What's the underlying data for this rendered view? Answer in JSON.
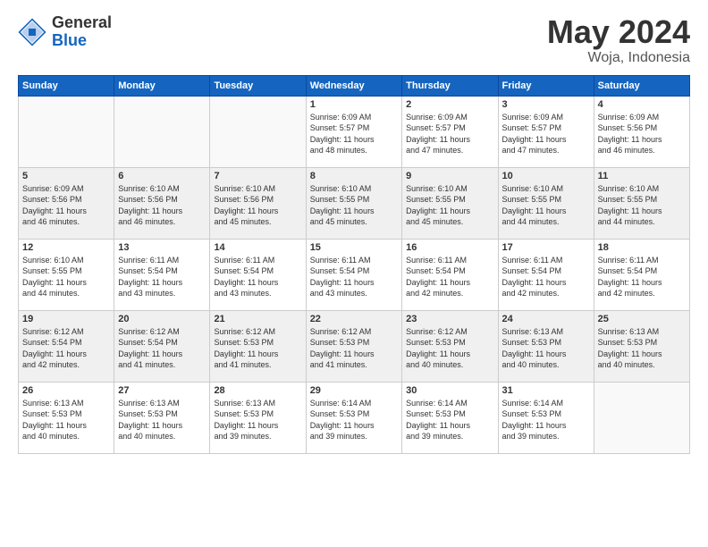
{
  "header": {
    "logo_general": "General",
    "logo_blue": "Blue",
    "month": "May 2024",
    "location": "Woja, Indonesia"
  },
  "days_of_week": [
    "Sunday",
    "Monday",
    "Tuesday",
    "Wednesday",
    "Thursday",
    "Friday",
    "Saturday"
  ],
  "weeks": [
    [
      {
        "day": "",
        "info": ""
      },
      {
        "day": "",
        "info": ""
      },
      {
        "day": "",
        "info": ""
      },
      {
        "day": "1",
        "info": "Sunrise: 6:09 AM\nSunset: 5:57 PM\nDaylight: 11 hours\nand 48 minutes."
      },
      {
        "day": "2",
        "info": "Sunrise: 6:09 AM\nSunset: 5:57 PM\nDaylight: 11 hours\nand 47 minutes."
      },
      {
        "day": "3",
        "info": "Sunrise: 6:09 AM\nSunset: 5:57 PM\nDaylight: 11 hours\nand 47 minutes."
      },
      {
        "day": "4",
        "info": "Sunrise: 6:09 AM\nSunset: 5:56 PM\nDaylight: 11 hours\nand 46 minutes."
      }
    ],
    [
      {
        "day": "5",
        "info": "Sunrise: 6:09 AM\nSunset: 5:56 PM\nDaylight: 11 hours\nand 46 minutes."
      },
      {
        "day": "6",
        "info": "Sunrise: 6:10 AM\nSunset: 5:56 PM\nDaylight: 11 hours\nand 46 minutes."
      },
      {
        "day": "7",
        "info": "Sunrise: 6:10 AM\nSunset: 5:56 PM\nDaylight: 11 hours\nand 45 minutes."
      },
      {
        "day": "8",
        "info": "Sunrise: 6:10 AM\nSunset: 5:55 PM\nDaylight: 11 hours\nand 45 minutes."
      },
      {
        "day": "9",
        "info": "Sunrise: 6:10 AM\nSunset: 5:55 PM\nDaylight: 11 hours\nand 45 minutes."
      },
      {
        "day": "10",
        "info": "Sunrise: 6:10 AM\nSunset: 5:55 PM\nDaylight: 11 hours\nand 44 minutes."
      },
      {
        "day": "11",
        "info": "Sunrise: 6:10 AM\nSunset: 5:55 PM\nDaylight: 11 hours\nand 44 minutes."
      }
    ],
    [
      {
        "day": "12",
        "info": "Sunrise: 6:10 AM\nSunset: 5:55 PM\nDaylight: 11 hours\nand 44 minutes."
      },
      {
        "day": "13",
        "info": "Sunrise: 6:11 AM\nSunset: 5:54 PM\nDaylight: 11 hours\nand 43 minutes."
      },
      {
        "day": "14",
        "info": "Sunrise: 6:11 AM\nSunset: 5:54 PM\nDaylight: 11 hours\nand 43 minutes."
      },
      {
        "day": "15",
        "info": "Sunrise: 6:11 AM\nSunset: 5:54 PM\nDaylight: 11 hours\nand 43 minutes."
      },
      {
        "day": "16",
        "info": "Sunrise: 6:11 AM\nSunset: 5:54 PM\nDaylight: 11 hours\nand 42 minutes."
      },
      {
        "day": "17",
        "info": "Sunrise: 6:11 AM\nSunset: 5:54 PM\nDaylight: 11 hours\nand 42 minutes."
      },
      {
        "day": "18",
        "info": "Sunrise: 6:11 AM\nSunset: 5:54 PM\nDaylight: 11 hours\nand 42 minutes."
      }
    ],
    [
      {
        "day": "19",
        "info": "Sunrise: 6:12 AM\nSunset: 5:54 PM\nDaylight: 11 hours\nand 42 minutes."
      },
      {
        "day": "20",
        "info": "Sunrise: 6:12 AM\nSunset: 5:54 PM\nDaylight: 11 hours\nand 41 minutes."
      },
      {
        "day": "21",
        "info": "Sunrise: 6:12 AM\nSunset: 5:53 PM\nDaylight: 11 hours\nand 41 minutes."
      },
      {
        "day": "22",
        "info": "Sunrise: 6:12 AM\nSunset: 5:53 PM\nDaylight: 11 hours\nand 41 minutes."
      },
      {
        "day": "23",
        "info": "Sunrise: 6:12 AM\nSunset: 5:53 PM\nDaylight: 11 hours\nand 40 minutes."
      },
      {
        "day": "24",
        "info": "Sunrise: 6:13 AM\nSunset: 5:53 PM\nDaylight: 11 hours\nand 40 minutes."
      },
      {
        "day": "25",
        "info": "Sunrise: 6:13 AM\nSunset: 5:53 PM\nDaylight: 11 hours\nand 40 minutes."
      }
    ],
    [
      {
        "day": "26",
        "info": "Sunrise: 6:13 AM\nSunset: 5:53 PM\nDaylight: 11 hours\nand 40 minutes."
      },
      {
        "day": "27",
        "info": "Sunrise: 6:13 AM\nSunset: 5:53 PM\nDaylight: 11 hours\nand 40 minutes."
      },
      {
        "day": "28",
        "info": "Sunrise: 6:13 AM\nSunset: 5:53 PM\nDaylight: 11 hours\nand 39 minutes."
      },
      {
        "day": "29",
        "info": "Sunrise: 6:14 AM\nSunset: 5:53 PM\nDaylight: 11 hours\nand 39 minutes."
      },
      {
        "day": "30",
        "info": "Sunrise: 6:14 AM\nSunset: 5:53 PM\nDaylight: 11 hours\nand 39 minutes."
      },
      {
        "day": "31",
        "info": "Sunrise: 6:14 AM\nSunset: 5:53 PM\nDaylight: 11 hours\nand 39 minutes."
      },
      {
        "day": "",
        "info": ""
      }
    ]
  ]
}
